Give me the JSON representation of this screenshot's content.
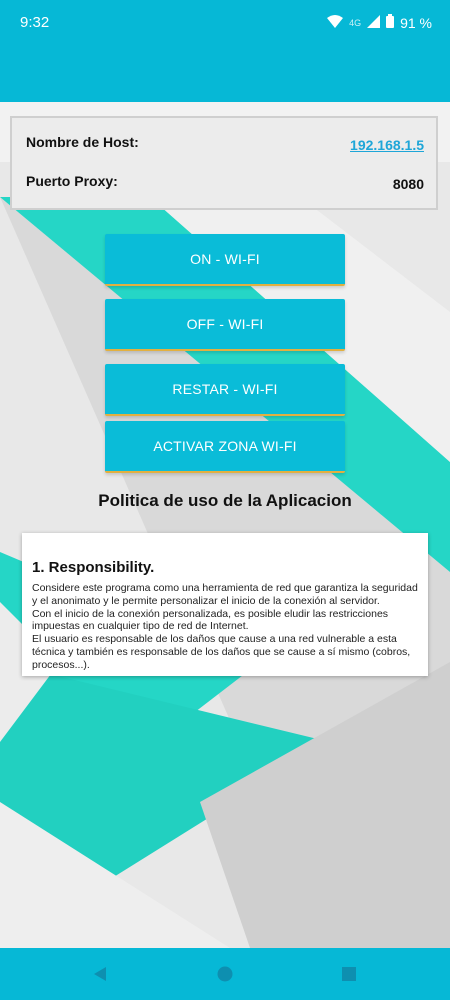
{
  "status_bar": {
    "time": "9:32",
    "network": "4G",
    "battery": "91 %"
  },
  "info": {
    "host_label": "Nombre de Host:",
    "host_value": "192.168.1.5",
    "proxy_label": "Puerto Proxy:",
    "proxy_value": "8080"
  },
  "buttons": {
    "on": "ON - WI-FI",
    "off": "OFF - WI-FI",
    "restart": "RESTAR - WI-FI",
    "hotspot": "ACTIVAR ZONA WI-FI"
  },
  "policy": {
    "title": "Politica de uso de la Aplicacion",
    "heading": "1. Responsibility.",
    "body": "Considere este programa como una herramienta de red que garantiza la seguridad y el anonimato y le permite personalizar el inicio de la conexión al servidor.\n Con el inicio de la conexión personalizada, es posible eludir las restricciones impuestas en cualquier tipo de red de Internet.\nEl usuario es responsable de los daños que cause a una red vulnerable a esta técnica y también es responsable de los daños que se cause a sí mismo (cobros, procesos...)."
  },
  "colors": {
    "primary": "#06b8d6",
    "teal": "#22d8c8",
    "button": "#0abcd8",
    "link": "#1ea6d8"
  },
  "icons": [
    "wifi-icon",
    "signal-icon",
    "battery-icon",
    "back-icon",
    "home-icon",
    "recents-icon"
  ]
}
